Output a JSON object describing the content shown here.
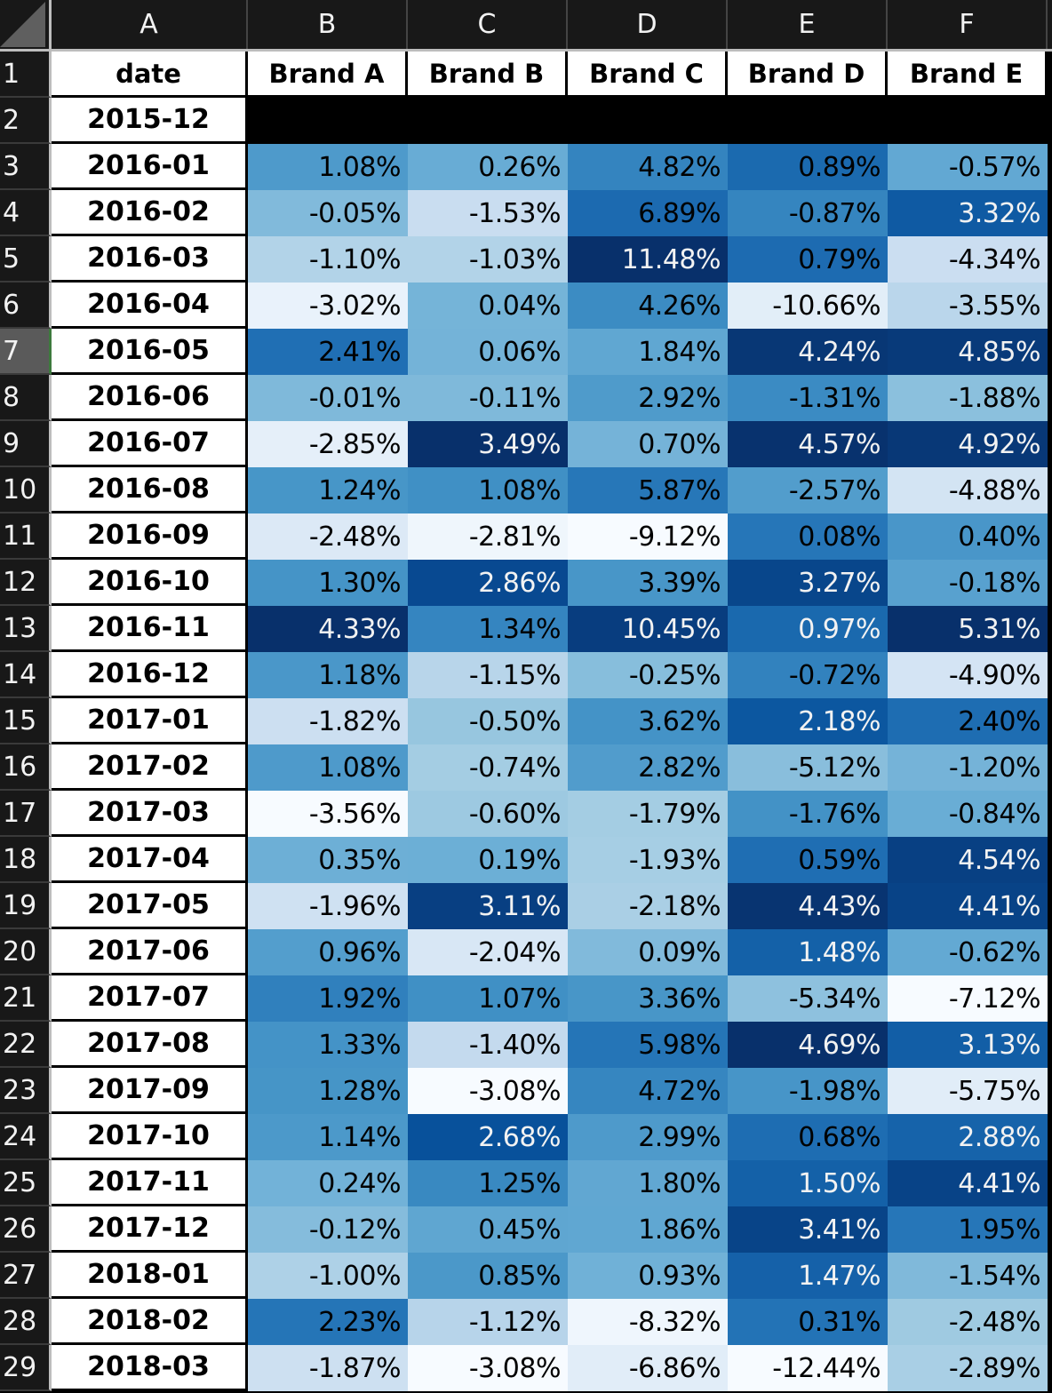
{
  "column_letters": [
    "A",
    "B",
    "C",
    "D",
    "E",
    "F"
  ],
  "selected_row": 7,
  "header_row": {
    "row_number": 1,
    "cells": [
      "date",
      "Brand A",
      "Brand B",
      "Brand C",
      "Brand D",
      "Brand E"
    ]
  },
  "rows": [
    {
      "n": 2,
      "date": "2015-12",
      "values": [
        "",
        "",
        "",
        "",
        ""
      ]
    },
    {
      "n": 3,
      "date": "2016-01",
      "values": [
        "1.08%",
        "0.26%",
        "4.82%",
        "0.89%",
        "-0.57%"
      ]
    },
    {
      "n": 4,
      "date": "2016-02",
      "values": [
        "-0.05%",
        "-1.53%",
        "6.89%",
        "-0.87%",
        "3.32%"
      ]
    },
    {
      "n": 5,
      "date": "2016-03",
      "values": [
        "-1.10%",
        "-1.03%",
        "11.48%",
        "0.79%",
        "-4.34%"
      ]
    },
    {
      "n": 6,
      "date": "2016-04",
      "values": [
        "-3.02%",
        "0.04%",
        "4.26%",
        "-10.66%",
        "-3.55%"
      ]
    },
    {
      "n": 7,
      "date": "2016-05",
      "values": [
        "2.41%",
        "0.06%",
        "1.84%",
        "4.24%",
        "4.85%"
      ]
    },
    {
      "n": 8,
      "date": "2016-06",
      "values": [
        "-0.01%",
        "-0.11%",
        "2.92%",
        "-1.31%",
        "-1.88%"
      ]
    },
    {
      "n": 9,
      "date": "2016-07",
      "values": [
        "-2.85%",
        "3.49%",
        "0.70%",
        "4.57%",
        "4.92%"
      ]
    },
    {
      "n": 10,
      "date": "2016-08",
      "values": [
        "1.24%",
        "1.08%",
        "5.87%",
        "-2.57%",
        "-4.88%"
      ]
    },
    {
      "n": 11,
      "date": "2016-09",
      "values": [
        "-2.48%",
        "-2.81%",
        "-9.12%",
        "0.08%",
        "0.40%"
      ]
    },
    {
      "n": 12,
      "date": "2016-10",
      "values": [
        "1.30%",
        "2.86%",
        "3.39%",
        "3.27%",
        "-0.18%"
      ]
    },
    {
      "n": 13,
      "date": "2016-11",
      "values": [
        "4.33%",
        "1.34%",
        "10.45%",
        "0.97%",
        "5.31%"
      ]
    },
    {
      "n": 14,
      "date": "2016-12",
      "values": [
        "1.18%",
        "-1.15%",
        "-0.25%",
        "-0.72%",
        "-4.90%"
      ]
    },
    {
      "n": 15,
      "date": "2017-01",
      "values": [
        "-1.82%",
        "-0.50%",
        "3.62%",
        "2.18%",
        "2.40%"
      ]
    },
    {
      "n": 16,
      "date": "2017-02",
      "values": [
        "1.08%",
        "-0.74%",
        "2.82%",
        "-5.12%",
        "-1.20%"
      ]
    },
    {
      "n": 17,
      "date": "2017-03",
      "values": [
        "-3.56%",
        "-0.60%",
        "-1.79%",
        "-1.76%",
        "-0.84%"
      ]
    },
    {
      "n": 18,
      "date": "2017-04",
      "values": [
        "0.35%",
        "0.19%",
        "-1.93%",
        "0.59%",
        "4.54%"
      ]
    },
    {
      "n": 19,
      "date": "2017-05",
      "values": [
        "-1.96%",
        "3.11%",
        "-2.18%",
        "4.43%",
        "4.41%"
      ]
    },
    {
      "n": 20,
      "date": "2017-06",
      "values": [
        "0.96%",
        "-2.04%",
        "0.09%",
        "1.48%",
        "-0.62%"
      ]
    },
    {
      "n": 21,
      "date": "2017-07",
      "values": [
        "1.92%",
        "1.07%",
        "3.36%",
        "-5.34%",
        "-7.12%"
      ]
    },
    {
      "n": 22,
      "date": "2017-08",
      "values": [
        "1.33%",
        "-1.40%",
        "5.98%",
        "4.69%",
        "3.13%"
      ]
    },
    {
      "n": 23,
      "date": "2017-09",
      "values": [
        "1.28%",
        "-3.08%",
        "4.72%",
        "-1.98%",
        "-5.75%"
      ]
    },
    {
      "n": 24,
      "date": "2017-10",
      "values": [
        "1.14%",
        "2.68%",
        "2.99%",
        "0.68%",
        "2.88%"
      ]
    },
    {
      "n": 25,
      "date": "2017-11",
      "values": [
        "0.24%",
        "1.25%",
        "1.80%",
        "1.50%",
        "4.41%"
      ]
    },
    {
      "n": 26,
      "date": "2017-12",
      "values": [
        "-0.12%",
        "0.45%",
        "1.86%",
        "3.41%",
        "1.95%"
      ]
    },
    {
      "n": 27,
      "date": "2018-01",
      "values": [
        "-1.00%",
        "0.85%",
        "0.93%",
        "1.47%",
        "-1.54%"
      ]
    },
    {
      "n": 28,
      "date": "2018-02",
      "values": [
        "2.23%",
        "-1.12%",
        "-8.32%",
        "0.31%",
        "-2.48%"
      ]
    },
    {
      "n": 29,
      "date": "2018-03",
      "values": [
        "-1.87%",
        "-3.08%",
        "-6.86%",
        "-12.44%",
        "-2.89%"
      ]
    }
  ],
  "colormap": {
    "name": "Blues",
    "low": "#f7fbff",
    "high": "#08306b",
    "light_text": "#f2f2f2",
    "dark_text": "#000000"
  }
}
